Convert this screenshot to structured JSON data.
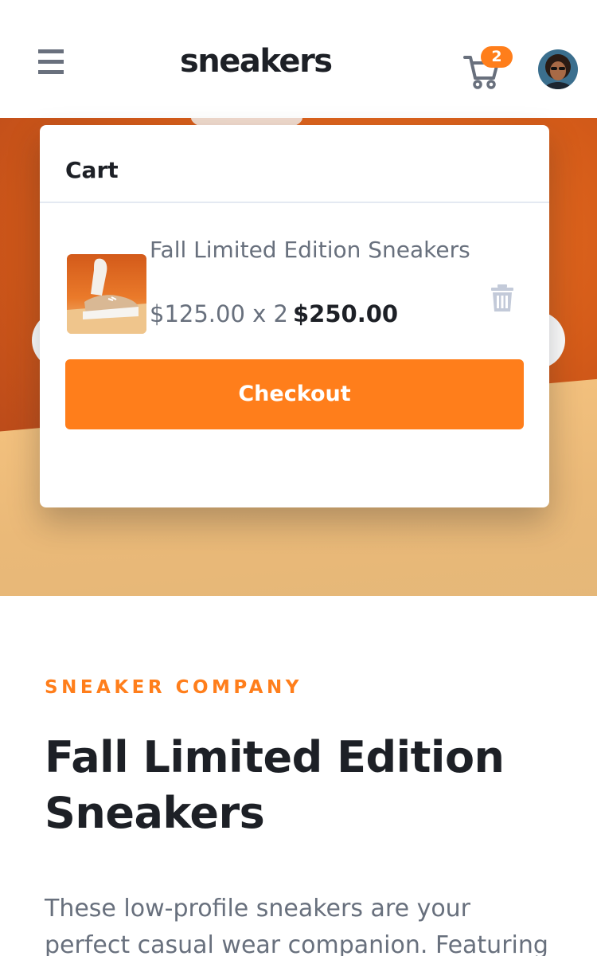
{
  "header": {
    "logo": "sneakers",
    "cart_badge_count": "2",
    "icons": {
      "menu": "hamburger-menu-icon",
      "cart": "shopping-cart-icon",
      "avatar": "user-avatar"
    }
  },
  "cart": {
    "title": "Cart",
    "item": {
      "name": "Fall Limited Edition Sneakers",
      "unit_price_text": "$125.00 x 2",
      "total_text": "$250.00"
    },
    "checkout_label": "Checkout"
  },
  "product": {
    "company": "SNEAKER COMPANY",
    "title": "Fall Limited Edition Sneakers",
    "description": "These low-profile sneakers are your perfect casual wear companion. Featuring"
  },
  "colors": {
    "accent": "#ff7e1b",
    "dark_text": "#1d2026",
    "gray_text": "#68707d",
    "icon_gray": "#b6bcc8"
  }
}
